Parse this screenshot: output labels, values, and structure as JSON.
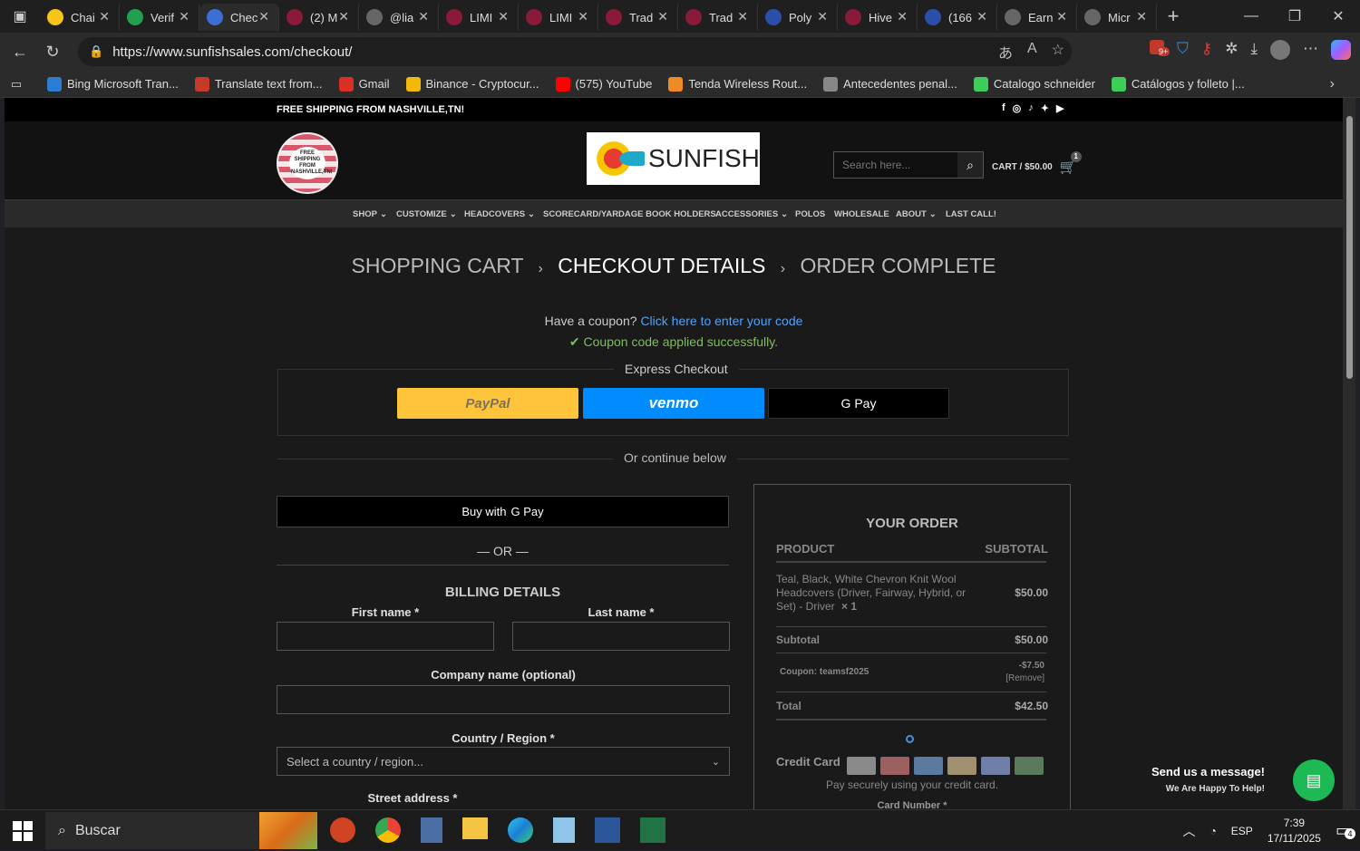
{
  "browser": {
    "tabs": [
      {
        "label": "Chai",
        "color": "#f5c518"
      },
      {
        "label": "Verif",
        "color": "#21a04d"
      },
      {
        "label": "Chec",
        "color": "#3b6fd6"
      },
      {
        "label": "(2) M",
        "color": "#8b1a3a"
      },
      {
        "label": "@lia",
        "color": "#666666"
      },
      {
        "label": "LIMI",
        "color": "#8b1a3a"
      },
      {
        "label": "LIMI",
        "color": "#8b1a3a"
      },
      {
        "label": "Trad",
        "color": "#8b1a3a"
      },
      {
        "label": "Trad",
        "color": "#8b1a3a"
      },
      {
        "label": "Poly",
        "color": "#2b4fa8"
      },
      {
        "label": "Hive",
        "color": "#8b1a3a"
      },
      {
        "label": "(166",
        "color": "#2b4fa8"
      },
      {
        "label": "Earn",
        "color": "#666666"
      },
      {
        "label": "Micr",
        "color": "#666666"
      }
    ],
    "url": "https://www.sunfishsales.com/checkout/",
    "bookmarks": [
      {
        "label": "Bing Microsoft Tran...",
        "color": "#2b7cd3"
      },
      {
        "label": "Translate text from...",
        "color": "#c73a2a"
      },
      {
        "label": "Gmail",
        "color": "#d93025"
      },
      {
        "label": "Binance - Cryptocur...",
        "color": "#f0b90b"
      },
      {
        "label": "(575) YouTube",
        "color": "#ff0000"
      },
      {
        "label": "Tenda Wireless Rout...",
        "color": "#f08a24"
      },
      {
        "label": "Antecedentes penal...",
        "color": "#888888"
      },
      {
        "label": "Catalogo schneider",
        "color": "#3dcd58"
      },
      {
        "label": "Catálogos y folleto |...",
        "color": "#3dcd58"
      }
    ],
    "notification_count": "9+"
  },
  "site": {
    "top_strip": "FREE SHIPPING FROM NASHVILLE,TN!",
    "badge_text": "FREE SHIPPING FROM NASHVILLE,TN!",
    "logo_text": "SUNFISH",
    "search_placeholder": "Search here...",
    "cart_label": "CART / $50.00",
    "cart_count": "1",
    "nav": [
      "SHOP",
      "CUSTOMIZE",
      "HEADCOVERS",
      "SCORECARD/YARDAGE BOOK HOLDERS",
      "ACCESSORIES",
      "POLOS",
      "WHOLESALE",
      "ABOUT",
      "LAST CALL!"
    ]
  },
  "checkout": {
    "steps": [
      "SHOPPING CART",
      "CHECKOUT DETAILS",
      "ORDER COMPLETE"
    ],
    "coupon_question": "Have a coupon?",
    "coupon_link": "Click here to enter your code",
    "coupon_success": "Coupon code applied successfully.",
    "express_title": "Express Checkout",
    "paypal": "PayPal",
    "venmo": "venmo",
    "gpay": "G Pay",
    "continue": "Or continue below",
    "buy_with": "Buy with",
    "or": "— OR —",
    "billing_title": "BILLING DETAILS",
    "first_name": "First name *",
    "last_name": "Last name *",
    "company": "Company name (optional)",
    "country_label": "Country / Region *",
    "country_placeholder": "Select a country / region...",
    "street": "Street address *"
  },
  "order": {
    "title": "YOUR ORDER",
    "col_product": "PRODUCT",
    "col_subtotal": "SUBTOTAL",
    "product_name": "Teal, Black, White Chevron Knit Wool Headcovers (Driver, Fairway, Hybrid, or Set) - Driver",
    "product_qty": "× 1",
    "product_price": "$50.00",
    "subtotal_label": "Subtotal",
    "subtotal_value": "$50.00",
    "coupon_label": "Coupon: teamsf2025",
    "coupon_value": "-$7.50",
    "coupon_remove": "[Remove]",
    "total_label": "Total",
    "total_value": "$42.50",
    "credit_card": "Credit Card",
    "pay_secure": "Pay securely using your credit card.",
    "card_number": "Card Number *"
  },
  "chat": {
    "title": "Send us a message!",
    "subtitle": "We Are Happy To Help!"
  },
  "taskbar": {
    "search": "Buscar",
    "lang": "ESP",
    "time": "7:39",
    "date": "17/11/2025",
    "notif": "4"
  }
}
